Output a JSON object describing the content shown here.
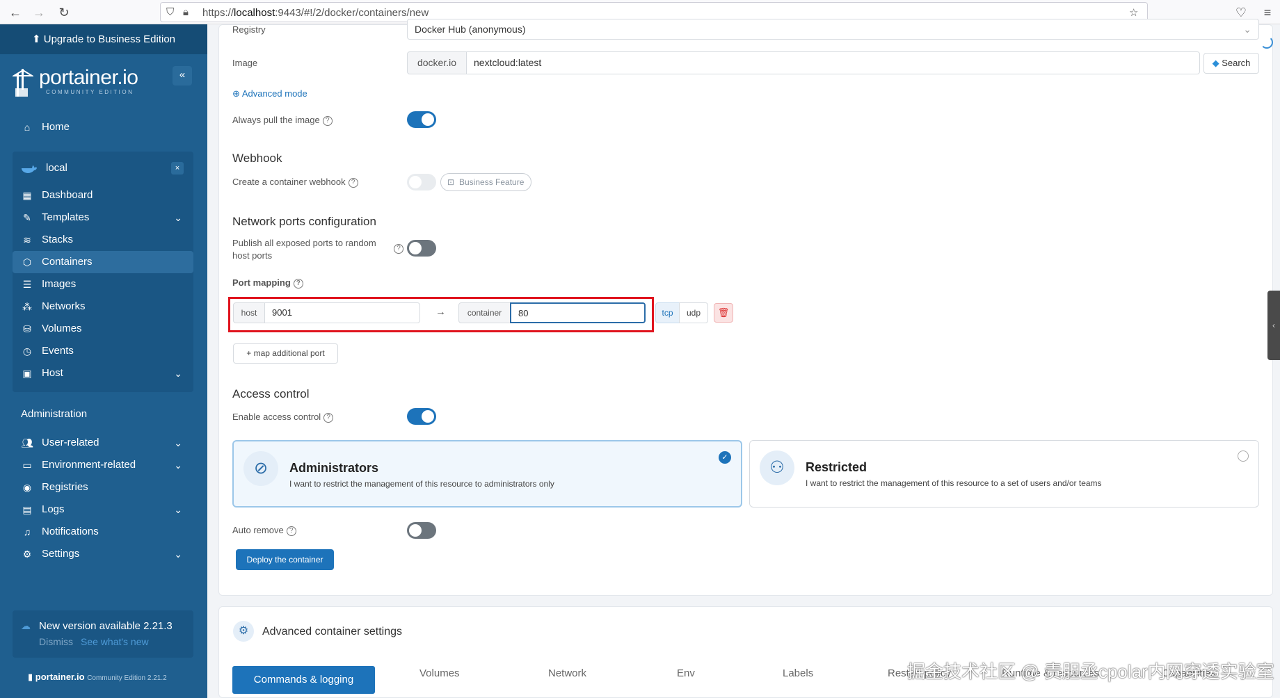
{
  "browser": {
    "url_prefix": "https://",
    "url_host": "localhost",
    "url_rest": ":9443/#!/2/docker/containers/new"
  },
  "sidebar": {
    "upgrade": "Upgrade to Business Edition",
    "logo": "portainer.io",
    "logo_sub": "COMMUNITY EDITION",
    "home": "Home",
    "environment": "local",
    "env_items": [
      {
        "label": "Dashboard",
        "icon": "dashboard-icon"
      },
      {
        "label": "Templates",
        "icon": "edit-icon"
      },
      {
        "label": "Stacks",
        "icon": "layers-icon"
      },
      {
        "label": "Containers",
        "icon": "box-icon"
      },
      {
        "label": "Images",
        "icon": "list-icon"
      },
      {
        "label": "Networks",
        "icon": "network-icon"
      },
      {
        "label": "Volumes",
        "icon": "database-icon"
      },
      {
        "label": "Events",
        "icon": "clock-icon"
      },
      {
        "label": "Host",
        "icon": "server-icon"
      }
    ],
    "admin_title": "Administration",
    "admin_items": [
      {
        "label": "User-related"
      },
      {
        "label": "Environment-related"
      },
      {
        "label": "Registries"
      },
      {
        "label": "Logs"
      },
      {
        "label": "Notifications"
      },
      {
        "label": "Settings"
      }
    ],
    "update_title": "New version available 2.21.3",
    "dismiss": "Dismiss",
    "see_new": "See what's new",
    "footer_logo": "portainer.io",
    "footer_edition": "Community Edition 2.21.2"
  },
  "form": {
    "registry_label": "Registry",
    "registry_value": "Docker Hub (anonymous)",
    "image_label": "Image",
    "image_prefix": "docker.io",
    "image_value": "nextcloud:latest",
    "search_btn": "Search",
    "advanced_mode": "Advanced mode",
    "always_pull": "Always pull the image",
    "webhook_heading": "Webhook",
    "webhook_label": "Create a container webhook",
    "business_feature": "Business Feature",
    "network_heading": "Network ports configuration",
    "publish_label_1": "Publish all exposed ports to random",
    "publish_label_2": "host ports",
    "port_mapping": "Port mapping",
    "host_addon": "host",
    "host_value": "9001",
    "container_addon": "container",
    "container_value": "80",
    "tcp": "tcp",
    "udp": "udp",
    "map_additional": "map additional port",
    "access_heading": "Access control",
    "enable_access": "Enable access control",
    "admin_title": "Administrators",
    "admin_desc": "I want to restrict the management of this resource to administrators only",
    "restricted_title": "Restricted",
    "restricted_desc": "I want to restrict the management of this resource to a set of users and/or teams",
    "auto_remove": "Auto remove",
    "deploy_btn": "Deploy the container"
  },
  "advanced": {
    "title": "Advanced container settings",
    "tabs": [
      "Commands & logging",
      "Volumes",
      "Network",
      "Env",
      "Labels",
      "Restart policy",
      "Runtime & resources",
      "Capabilities"
    ]
  },
  "watermark": "掘金技术社区 @ 责胆丞cpolar内网穿透实验室",
  "colors": {
    "sidebar": "#1f5f8f",
    "accent": "#1d73ba",
    "highlight": "#e0141e"
  }
}
